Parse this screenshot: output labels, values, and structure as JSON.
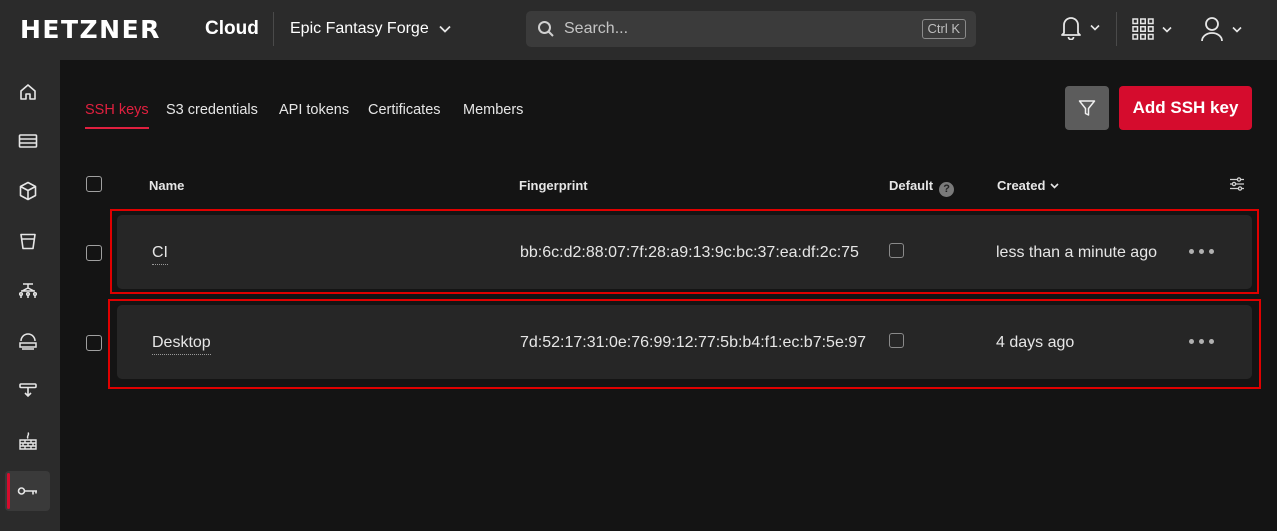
{
  "header": {
    "logo": "HETZNER",
    "logo_sub": "Cloud",
    "project_name": "Epic Fantasy Forge",
    "search": {
      "placeholder": "Search...",
      "shortcut": "Ctrl K"
    }
  },
  "sidebar": {
    "items": [
      {
        "name": "home",
        "icon": "home-icon"
      },
      {
        "name": "servers",
        "icon": "server-icon"
      },
      {
        "name": "volumes",
        "icon": "cube-icon"
      },
      {
        "name": "object-storage",
        "icon": "bucket-icon"
      },
      {
        "name": "networks",
        "icon": "network-icon"
      },
      {
        "name": "load-balancers",
        "icon": "load-balancer-icon"
      },
      {
        "name": "floating-ips",
        "icon": "floating-ip-icon"
      },
      {
        "name": "firewalls",
        "icon": "firewall-icon"
      },
      {
        "name": "security",
        "icon": "key-icon",
        "active": true
      }
    ]
  },
  "tabs": [
    {
      "label": "SSH keys",
      "active": true
    },
    {
      "label": "S3 credentials"
    },
    {
      "label": "API tokens"
    },
    {
      "label": "Certificates"
    },
    {
      "label": "Members"
    }
  ],
  "actions": {
    "add_label": "Add SSH key"
  },
  "table": {
    "columns": {
      "name": "Name",
      "fingerprint": "Fingerprint",
      "default": "Default",
      "created": "Created"
    },
    "rows": [
      {
        "name": "CI",
        "fingerprint": "bb:6c:d2:88:07:7f:28:a9:13:9c:bc:37:ea:df:2c:75",
        "default": false,
        "created": "less than a minute ago"
      },
      {
        "name": "Desktop",
        "fingerprint": "7d:52:17:31:0e:76:99:12:77:5b:b4:f1:ec:b7:5e:97",
        "default": false,
        "created": "4 days ago"
      }
    ]
  },
  "colors": {
    "accent": "#d50c2d",
    "highlight": "#e00000",
    "background": "#141414",
    "surface": "#2b2b2b"
  }
}
